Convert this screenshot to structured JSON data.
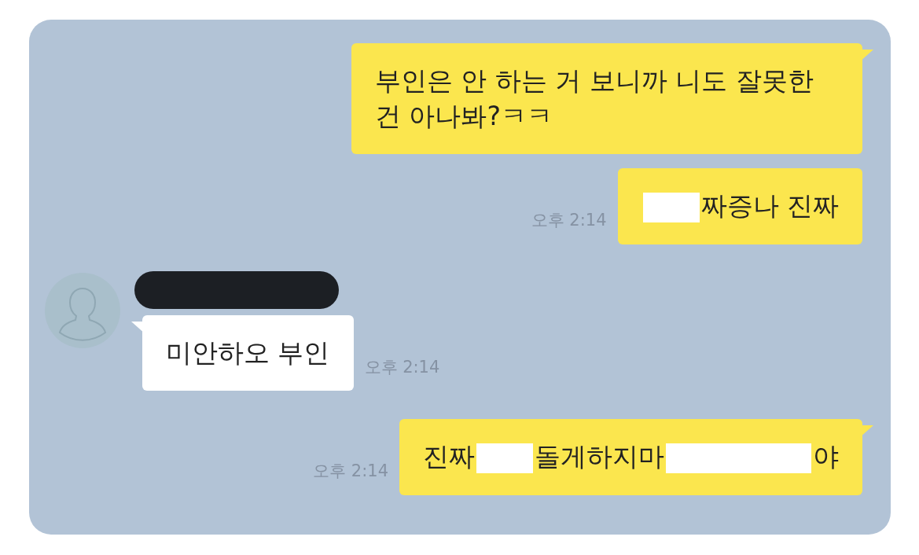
{
  "messages": [
    {
      "outgoing": true,
      "tail": true,
      "parts": [
        {
          "kind": "text",
          "text": "부인은 안 하는 거 보니까 니도 잘못한 건 아나봐?ㅋㅋ"
        }
      ]
    },
    {
      "outgoing": true,
      "tail": false,
      "time": "오후 2:14",
      "parts": [
        {
          "kind": "redaction"
        },
        {
          "kind": "text",
          "text": "짜증나 진짜"
        }
      ]
    },
    {
      "outgoing": false,
      "tail": true,
      "sender_hidden": true,
      "time": "오후 2:14",
      "parts": [
        {
          "kind": "text",
          "text": "미안하오 부인"
        }
      ]
    },
    {
      "outgoing": true,
      "tail": true,
      "time": "오후 2:14",
      "parts": [
        {
          "kind": "text",
          "text": "진짜"
        },
        {
          "kind": "redaction"
        },
        {
          "kind": "text",
          "text": "돌게하지마"
        },
        {
          "kind": "redaction"
        },
        {
          "kind": "text",
          "text": "야"
        }
      ]
    }
  ]
}
